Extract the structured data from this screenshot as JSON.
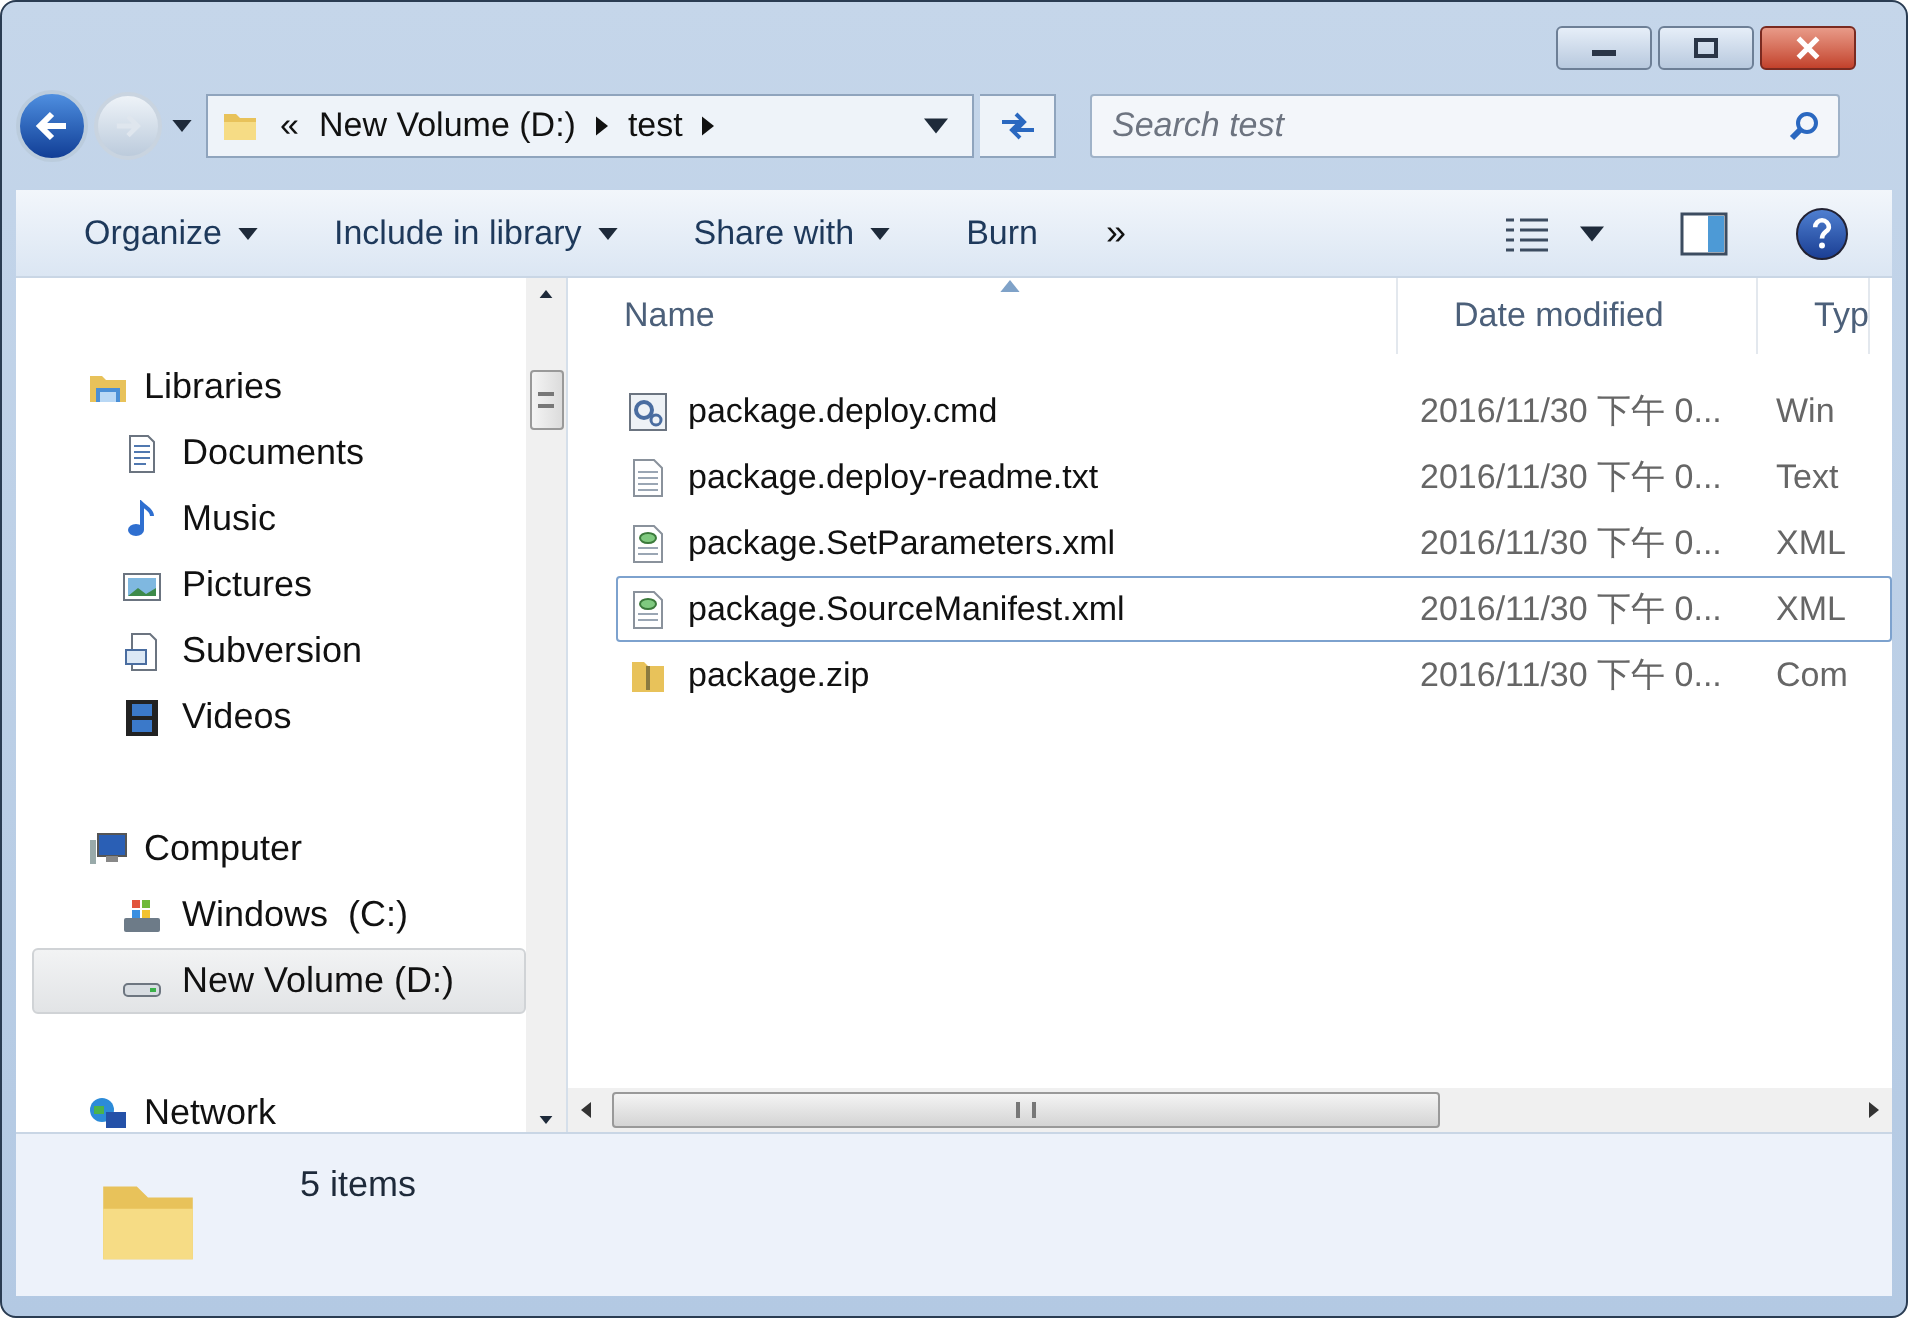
{
  "window": {
    "buttons": [
      {
        "kind": "minimize"
      },
      {
        "kind": "maximize"
      },
      {
        "kind": "close"
      }
    ]
  },
  "address_bar": {
    "overflow": "«",
    "crumbs": [
      "New Volume (D:)",
      "test"
    ]
  },
  "search": {
    "placeholder": "Search test"
  },
  "toolbar": {
    "items": [
      {
        "label": "Organize",
        "dropdown": true
      },
      {
        "label": "Include in library",
        "dropdown": true
      },
      {
        "label": "Share with",
        "dropdown": true
      },
      {
        "label": "Burn",
        "dropdown": false
      }
    ],
    "more": "»"
  },
  "sidebar": {
    "groups": [
      {
        "label": "Libraries",
        "kind": "library",
        "children": [
          {
            "label": "Documents",
            "kind": "documents",
            "selected": false
          },
          {
            "label": "Music",
            "kind": "music",
            "selected": false
          },
          {
            "label": "Pictures",
            "kind": "pictures",
            "selected": false
          },
          {
            "label": "Subversion",
            "kind": "subversion",
            "selected": false
          },
          {
            "label": "Videos",
            "kind": "videos",
            "selected": false
          }
        ]
      },
      {
        "label": "Computer",
        "kind": "computer",
        "children": [
          {
            "label": "Windows  (C:)",
            "kind": "windows-drive",
            "selected": false
          },
          {
            "label": "New Volume (D:)",
            "kind": "drive",
            "selected": true
          }
        ]
      },
      {
        "label": "Network",
        "kind": "network"
      }
    ]
  },
  "table": {
    "columns": [
      "Name",
      "Date modified",
      "Typ"
    ],
    "rows": [
      {
        "name": "package.deploy.cmd",
        "kind": "cmd",
        "date": "2016/11/30 下午 0...",
        "type": "Win",
        "focused": false
      },
      {
        "name": "package.deploy-readme.txt",
        "kind": "txt",
        "date": "2016/11/30 下午 0...",
        "type": "Text",
        "focused": false
      },
      {
        "name": "package.SetParameters.xml",
        "kind": "xml",
        "date": "2016/11/30 下午 0...",
        "type": "XML",
        "focused": false
      },
      {
        "name": "package.SourceManifest.xml",
        "kind": "xml",
        "date": "2016/11/30 下午 0...",
        "type": "XML",
        "focused": true
      },
      {
        "name": "package.zip",
        "kind": "zip",
        "date": "2016/11/30 下午 0...",
        "type": "Com",
        "focused": false
      }
    ]
  },
  "status_bar": {
    "text": "5 items"
  }
}
